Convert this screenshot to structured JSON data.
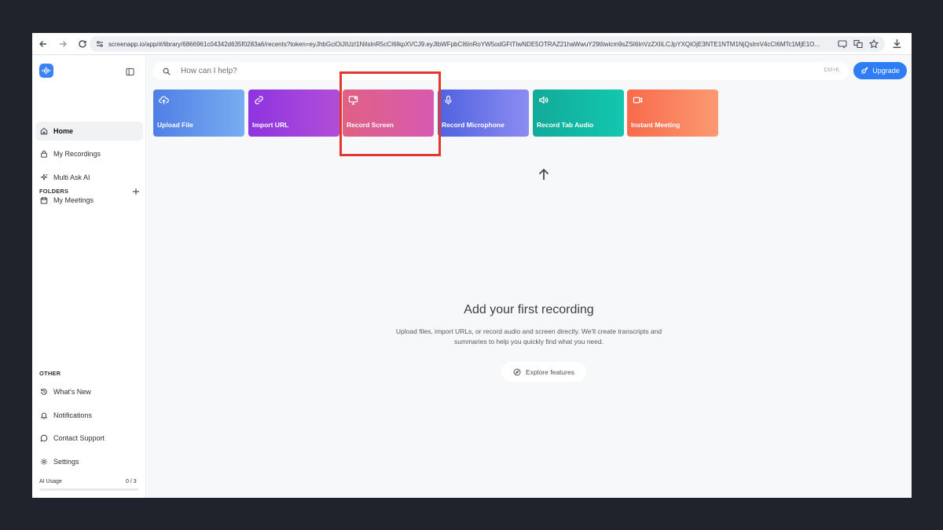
{
  "browser": {
    "url": "screenapp.io/app/#/library/6866961c04342d635f0283a6/recents?token=eyJhbGciOiJIUzI1NiIsInR5cCI6IkpXVCJ9.eyJlbWFpbCI6InRoYW5odGFtTIwNDE5OTRAZ21haWwuY29tIiwicm9sZSI6InVzZXIiLCJpYXQiOjE3NTE1NTM1NjQsImV4cCI6MTc1MjE1O..."
  },
  "sidebar": {
    "nav": [
      {
        "label": "Home",
        "icon": "home-icon",
        "active": true
      },
      {
        "label": "My Recordings",
        "icon": "lock-icon"
      },
      {
        "label": "Multi Ask AI",
        "icon": "sparkle-icon"
      },
      {
        "label": "My Meetings",
        "icon": "calendar-icon"
      }
    ],
    "folders_label": "FOLDERS",
    "other_label": "OTHER",
    "other": [
      {
        "label": "What's New",
        "icon": "history-icon"
      },
      {
        "label": "Notifications",
        "icon": "bell-icon"
      },
      {
        "label": "Contact Support",
        "icon": "chat-icon"
      },
      {
        "label": "Settings",
        "icon": "gear-icon"
      }
    ],
    "usage": {
      "label": "AI Usage",
      "count": "0 / 3",
      "progress": 0
    }
  },
  "search": {
    "placeholder": "How can I help?",
    "shortcut": "Ctrl+K"
  },
  "upgrade_label": "Upgrade",
  "cards": [
    {
      "label": "Upload File",
      "icon": "cloud-upload-icon"
    },
    {
      "label": "Import URL",
      "icon": "link-icon"
    },
    {
      "label": "Record Screen",
      "icon": "monitor-icon"
    },
    {
      "label": "Record Microphone",
      "icon": "microphone-icon"
    },
    {
      "label": "Record Tab Audio",
      "icon": "speaker-icon"
    },
    {
      "label": "Instant Meeting",
      "icon": "video-icon"
    }
  ],
  "empty_state": {
    "title": "Add your first recording",
    "description": "Upload files, import URLs, or record audio and screen directly. We'll create transcripts and summaries to help you quickly find what you need.",
    "explore_label": "Explore features"
  },
  "colors": {
    "accent": "#2f7df6",
    "highlight": "#e2372f"
  }
}
